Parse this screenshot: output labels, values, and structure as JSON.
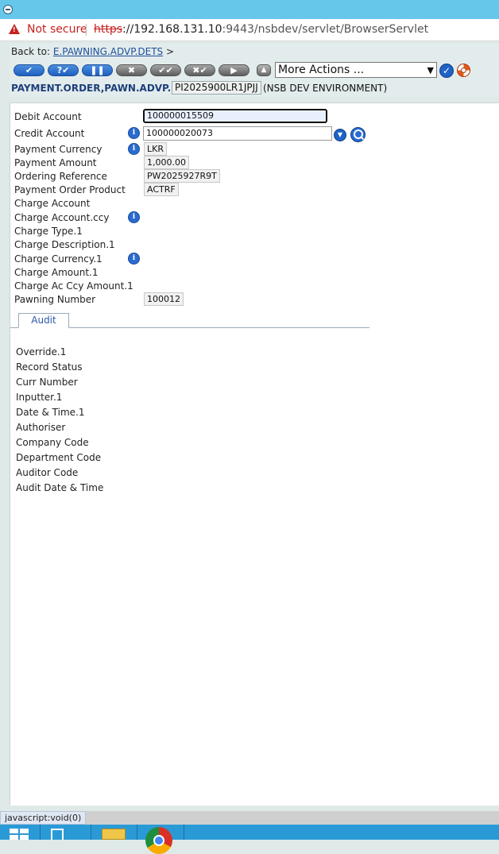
{
  "browser": {
    "security_warning": "Not secure",
    "url_scheme": "https",
    "url_host": "://192.168.131.10",
    "url_rest": ":9443/nsbdev/servlet/BrowserServlet"
  },
  "toolbar": {
    "back_prefix": "Back to:",
    "back_link": "E.PAWNING.ADVP.DETS",
    "back_suffix": ">",
    "buttons": [
      {
        "name": "commit",
        "glyph": "✔",
        "color": "blue"
      },
      {
        "name": "validate",
        "glyph": "?✔",
        "color": "blue"
      },
      {
        "name": "hold",
        "glyph": "❚❚",
        "color": "blue"
      },
      {
        "name": "delete",
        "glyph": "✖",
        "color": "gray"
      },
      {
        "name": "authorise",
        "glyph": "✔✔",
        "color": "gray"
      },
      {
        "name": "reverse",
        "glyph": "✖✔",
        "color": "gray"
      },
      {
        "name": "next",
        "glyph": "▶",
        "color": "gray"
      }
    ],
    "more_actions": "More Actions ...",
    "app_name": "PAYMENT.ORDER,PAWN.ADVP.NSB",
    "record_id": "PI2025900LR1JPJJ",
    "environment": "(NSB DEV ENVIRONMENT)"
  },
  "form": {
    "fields": [
      {
        "label": "Debit Account",
        "value": "100000015509",
        "info": false
      },
      {
        "label": "Credit Account",
        "value": "100000020073",
        "info": true
      },
      {
        "label": "Payment Currency",
        "value": "LKR",
        "info": true
      },
      {
        "label": "Payment Amount",
        "value": "1,000.00",
        "info": false
      },
      {
        "label": "Ordering Reference",
        "value": "PW2025927R9T",
        "info": false
      },
      {
        "label": "Payment Order Product",
        "value": "ACTRF",
        "info": false
      },
      {
        "label": "Charge Account",
        "value": "",
        "info": false
      },
      {
        "label": "Charge Account.ccy",
        "value": "",
        "info": true
      },
      {
        "label": "Charge Type.1",
        "value": "",
        "info": false
      },
      {
        "label": "Charge Description.1",
        "value": "",
        "info": false
      },
      {
        "label": "Charge Currency.1",
        "value": "",
        "info": true
      },
      {
        "label": "Charge Amount.1",
        "value": "",
        "info": false
      },
      {
        "label": "Charge Ac Ccy Amount.1",
        "value": "",
        "info": false
      },
      {
        "label": "Pawning Number",
        "value": "100012",
        "info": false
      }
    ],
    "tab_label": "Audit",
    "audit_fields": [
      "Override.1",
      "Record Status",
      "Curr Number",
      "Inputter.1",
      "Date & Time.1",
      "Authoriser",
      "Company Code",
      "Department Code",
      "Auditor Code",
      "Audit Date & Time"
    ]
  },
  "status_url": "javascript:void(0)"
}
